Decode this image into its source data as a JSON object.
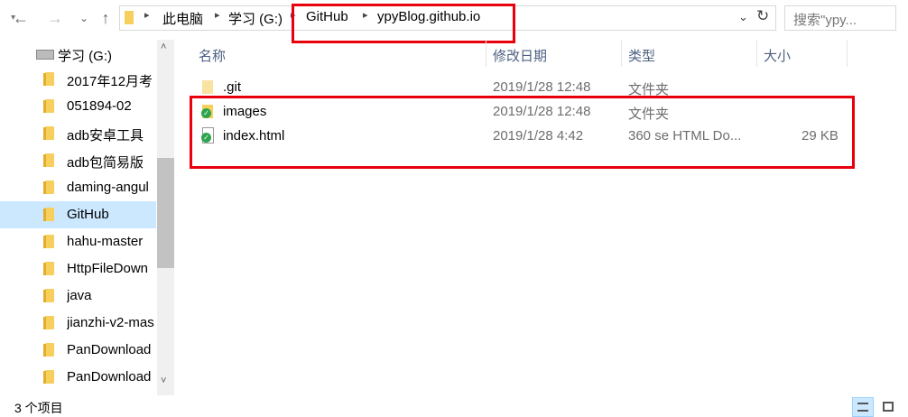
{
  "nav": {
    "path": [
      "此电脑",
      "学习 (G:)",
      "GitHub",
      "ypyBlog.github.io"
    ],
    "search_placeholder": "搜索\"ypy..."
  },
  "sidebar": {
    "drive_label": "学习 (G:)",
    "items": [
      {
        "label": "2017年12月考"
      },
      {
        "label": "051894-02"
      },
      {
        "label": "adb安卓工具"
      },
      {
        "label": "adb包简易版"
      },
      {
        "label": "daming-angul"
      },
      {
        "label": "GitHub",
        "selected": true
      },
      {
        "label": "hahu-master"
      },
      {
        "label": "HttpFileDown"
      },
      {
        "label": "java"
      },
      {
        "label": "jianzhi-v2-mas"
      },
      {
        "label": "PanDownload"
      },
      {
        "label": "PanDownload"
      }
    ]
  },
  "columns": {
    "name": "名称",
    "modified": "修改日期",
    "type": "类型",
    "size": "大小"
  },
  "files": [
    {
      "name": ".git",
      "modified": "2019/1/28 12:48",
      "type": "文件夹",
      "size": ""
    },
    {
      "name": "images",
      "modified": "2019/1/28 12:48",
      "type": "文件夹",
      "size": ""
    },
    {
      "name": "index.html",
      "modified": "2019/1/28 4:42",
      "type": "360 se HTML Do...",
      "size": "29 KB"
    }
  ],
  "status": {
    "count": "3 个项目"
  },
  "colors": {
    "highlight": "#e8000d",
    "selection": "#cce8ff",
    "header_text": "#4d6082"
  }
}
